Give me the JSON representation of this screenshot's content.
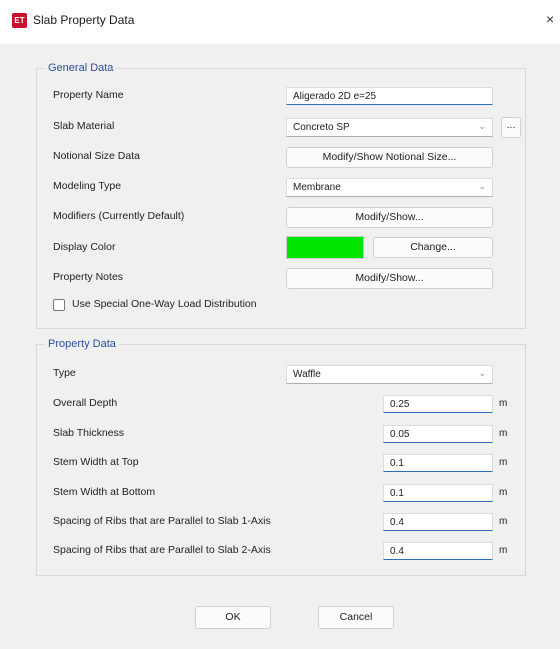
{
  "window": {
    "title": "Slab Property Data",
    "app_icon_text": "ET",
    "close_glyph": "×"
  },
  "general": {
    "title": "General Data",
    "property_name": {
      "label": "Property Name",
      "value": "Aligerado 2D e=25"
    },
    "slab_material": {
      "label": "Slab Material",
      "value": "Concreto SP",
      "extra_button": "..."
    },
    "notional_size": {
      "label": "Notional Size Data",
      "button": "Modify/Show Notional Size..."
    },
    "modeling_type": {
      "label": "Modeling Type",
      "value": "Membrane"
    },
    "modifiers": {
      "label": "Modifiers (Currently Default)",
      "button": "Modify/Show..."
    },
    "display_color": {
      "label": "Display Color",
      "color": "#00e600",
      "button": "Change..."
    },
    "property_notes": {
      "label": "Property Notes",
      "button": "Modify/Show..."
    },
    "one_way_checkbox": {
      "label": "Use Special One-Way Load Distribution",
      "checked": false
    }
  },
  "property": {
    "title": "Property Data",
    "type": {
      "label": "Type",
      "value": "Waffle"
    },
    "rows": [
      {
        "label": "Overall Depth",
        "value": "0.25",
        "unit": "m"
      },
      {
        "label": "Slab Thickness",
        "value": "0.05",
        "unit": "m"
      },
      {
        "label": "Stem Width at Top",
        "value": "0.1",
        "unit": "m"
      },
      {
        "label": "Stem Width at Bottom",
        "value": "0.1",
        "unit": "m"
      },
      {
        "label": "Spacing of Ribs that are Parallel to Slab 1-Axis",
        "value": "0.4",
        "unit": "m"
      },
      {
        "label": "Spacing of Ribs that are Parallel to Slab 2-Axis",
        "value": "0.4",
        "unit": "m"
      }
    ]
  },
  "buttons": {
    "ok": "OK",
    "cancel": "Cancel"
  },
  "icons": {
    "dropdown": "chevron-down-icon"
  }
}
